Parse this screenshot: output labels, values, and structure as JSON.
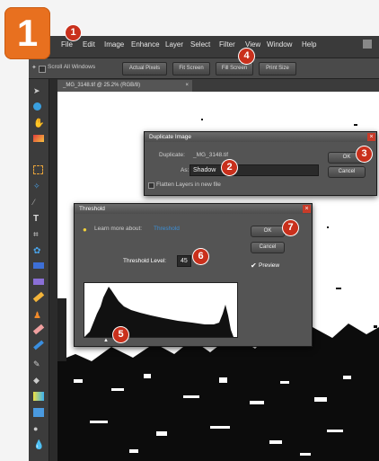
{
  "step_number": "1",
  "menu": [
    "File",
    "Edit",
    "Image",
    "Enhance",
    "Layer",
    "Select",
    "Filter",
    "View",
    "Window",
    "Help"
  ],
  "options_bar": {
    "scroll_all_windows": "Scroll All Windows",
    "buttons": [
      "Actual Pixels",
      "Fit Screen",
      "Fill Screen",
      "Print Size"
    ]
  },
  "document_tab": "_MG_3148.tif @ 25.2% (RGB/8)",
  "duplicate_dialog": {
    "title": "Duplicate Image",
    "duplicate_label": "Duplicate:",
    "duplicate_value": "_MG_3148.tif",
    "as_label": "As:",
    "as_value": "Shadow",
    "flatten_label": "Flatten Layers in new file",
    "ok": "OK",
    "cancel": "Cancel"
  },
  "threshold_dialog": {
    "title": "Threshold",
    "learn_prefix": "Learn more about:",
    "learn_link": "Threshold",
    "level_label": "Threshold Level:",
    "level_value": "45",
    "ok": "OK",
    "cancel": "Cancel",
    "preview": "Preview"
  },
  "callouts": [
    "1",
    "2",
    "3",
    "4",
    "5",
    "6",
    "7"
  ],
  "colors": {
    "step_badge": "#e8701f",
    "callout": "#c9301c",
    "link": "#3c8fd6"
  }
}
